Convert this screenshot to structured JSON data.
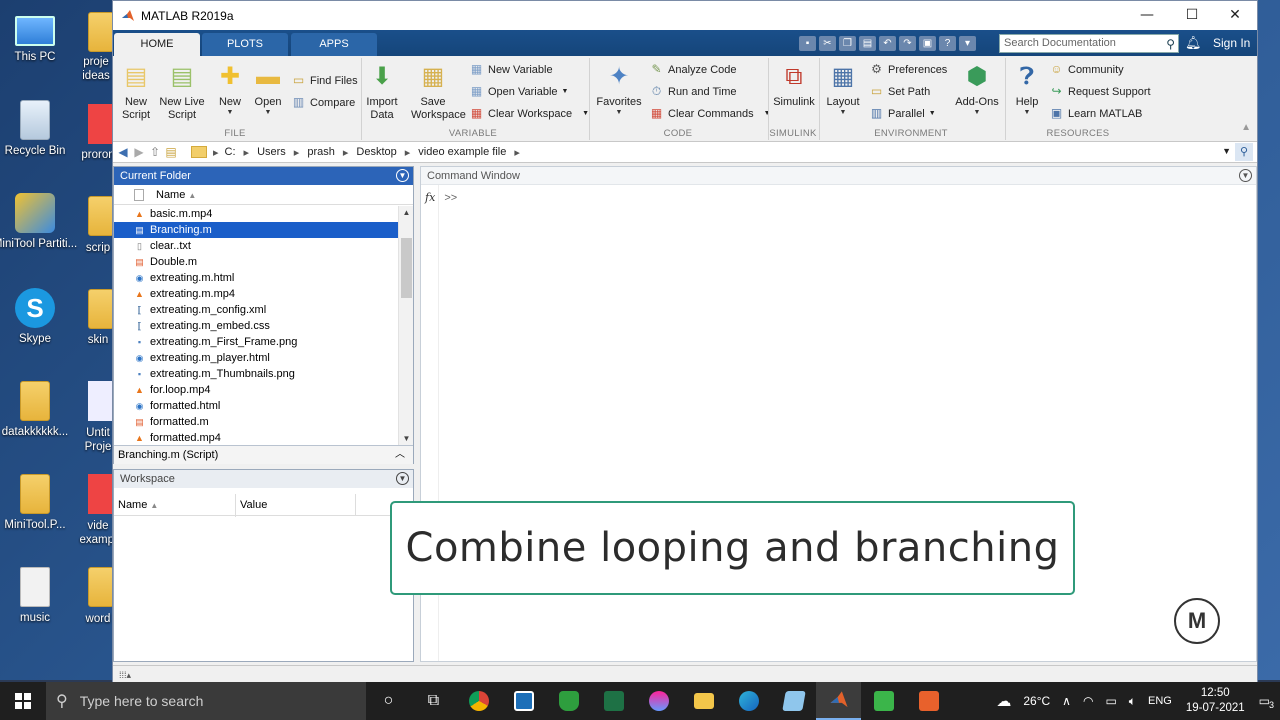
{
  "desktop": {
    "icons": [
      {
        "label": "This PC"
      },
      {
        "label": "Recycle Bin"
      },
      {
        "label": "MiniTool Partiti..."
      },
      {
        "label": "Skype"
      },
      {
        "label": "datakkkkkk..."
      },
      {
        "label": "MiniTool.P..."
      },
      {
        "label": "music"
      }
    ],
    "partial_labels": [
      "proje ideas",
      "proron",
      "scrip",
      "skin",
      "Untit Proje",
      "vide exampl",
      "word"
    ]
  },
  "window": {
    "title": "MATLAB R2019a",
    "controls": {
      "minimize": "—",
      "maximize": "☐",
      "close": "✕"
    }
  },
  "tabs": [
    {
      "label": "HOME",
      "active": true
    },
    {
      "label": "PLOTS",
      "active": false
    },
    {
      "label": "APPS",
      "active": false
    }
  ],
  "search": {
    "placeholder": "Search Documentation"
  },
  "signin": "Sign In",
  "ribbon": {
    "new_script": "New Script",
    "new_live_script": "New Live Script",
    "new": "New",
    "open": "Open",
    "find_files": "Find Files",
    "compare": "Compare",
    "import_data": "Import Data",
    "save_workspace": "Save Workspace",
    "new_variable": "New Variable",
    "open_variable": "Open Variable",
    "clear_workspace": "Clear Workspace",
    "favorites": "Favorites",
    "analyze_code": "Analyze Code",
    "run_and_time": "Run and Time",
    "clear_commands": "Clear Commands",
    "simulink": "Simulink",
    "layout": "Layout",
    "preferences": "Preferences",
    "set_path": "Set Path",
    "parallel": "Parallel",
    "add_ons": "Add-Ons",
    "help": "Help",
    "community": "Community",
    "request_support": "Request Support",
    "learn_matlab": "Learn MATLAB",
    "groups": {
      "file": "FILE",
      "variable": "VARIABLE",
      "code": "CODE",
      "simulink": "SIMULINK",
      "environment": "ENVIRONMENT",
      "resources": "RESOURCES"
    }
  },
  "address": {
    "path": [
      "C:",
      "Users",
      "prash",
      "Desktop",
      "video example file"
    ]
  },
  "current_folder": {
    "title": "Current Folder",
    "column_name": "Name",
    "files": [
      {
        "name": "basic.m.mp4",
        "type": "video"
      },
      {
        "name": "Branching.m",
        "type": "mfile",
        "selected": true
      },
      {
        "name": "clear..txt",
        "type": "text"
      },
      {
        "name": "Double.m",
        "type": "mfile"
      },
      {
        "name": "extreating.m.html",
        "type": "html"
      },
      {
        "name": "extreating.m.mp4",
        "type": "video"
      },
      {
        "name": "extreating.m_config.xml",
        "type": "xml"
      },
      {
        "name": "extreating.m_embed.css",
        "type": "xml"
      },
      {
        "name": "extreating.m_First_Frame.png",
        "type": "image"
      },
      {
        "name": "extreating.m_player.html",
        "type": "html"
      },
      {
        "name": "extreating.m_Thumbnails.png",
        "type": "image"
      },
      {
        "name": "for.loop.mp4",
        "type": "video"
      },
      {
        "name": "formatted.html",
        "type": "html"
      },
      {
        "name": "formatted.m",
        "type": "mfile"
      },
      {
        "name": "formatted.mp4",
        "type": "video"
      }
    ],
    "detail": "Branching.m  (Script)"
  },
  "workspace": {
    "title": "Workspace",
    "col_name": "Name",
    "col_value": "Value"
  },
  "command_window": {
    "title": "Command Window",
    "fx": "fx",
    "prompt": ">>"
  },
  "overlay": {
    "caption": "Combine looping and branching"
  },
  "taskbar": {
    "search_placeholder": "Type here to search",
    "weather": "26°C",
    "language": "ENG",
    "time": "12:50",
    "date": "19-07-2021",
    "notifications": "3"
  },
  "colors": {
    "matlab_blue": "#1a4f8a",
    "selection": "#1a5ec9",
    "overlay_border": "#2f9a7a"
  }
}
